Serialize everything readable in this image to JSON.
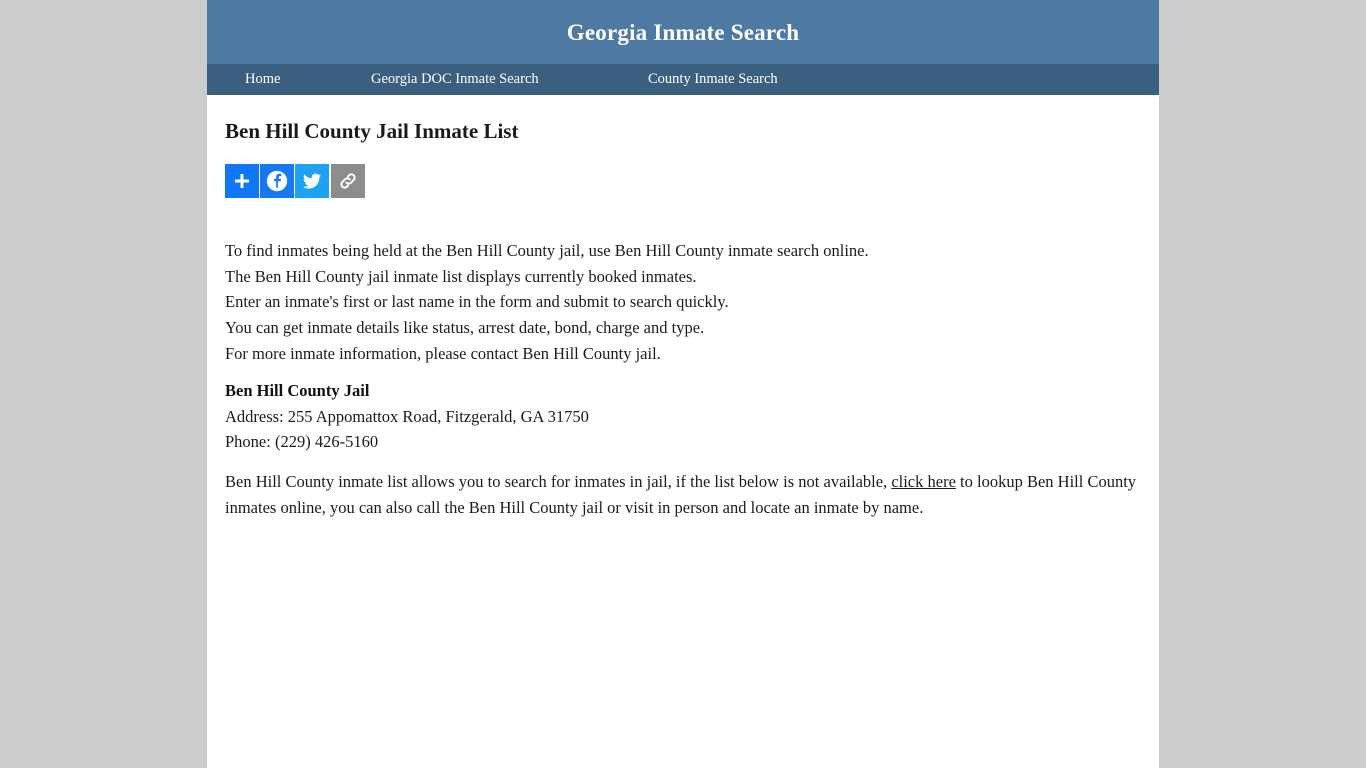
{
  "site": {
    "title": "Georgia Inmate Search"
  },
  "nav": {
    "items": [
      {
        "label": "Home",
        "name": "nav-item-home"
      },
      {
        "label": "Georgia DOC Inmate Search",
        "name": "nav-item-georgia-doc-inmate-search"
      },
      {
        "label": "County Inmate Search",
        "name": "nav-item-county-inmate-search"
      }
    ]
  },
  "page": {
    "title": "Ben Hill County Jail Inmate List"
  },
  "share": {
    "buttons": [
      {
        "label": "Share",
        "icon": "plus-icon",
        "color": "#0f76f5"
      },
      {
        "label": "Facebook",
        "icon": "facebook-icon",
        "color": "#1877f2"
      },
      {
        "label": "Twitter",
        "icon": "twitter-icon",
        "color": "#1da1f2"
      },
      {
        "label": "Copy Link",
        "icon": "link-icon",
        "color": "#8c8c8c"
      }
    ]
  },
  "intro": {
    "lines": [
      "To find inmates being held at the Ben Hill County jail, use Ben Hill County inmate search online.",
      "The Ben Hill County jail inmate list displays currently booked inmates.",
      "Enter an inmate's first or last name in the form and submit to search quickly.",
      "You can get inmate details like status, arrest date, bond, charge and type.",
      "For more inmate information, please contact Ben Hill County jail."
    ]
  },
  "jail": {
    "name": "Ben Hill County Jail",
    "address": "Address: 255 Appomattox Road, Fitzgerald, GA 31750",
    "phone": "Phone: (229) 426-5160"
  },
  "closing": {
    "before_link": "Ben Hill County inmate list allows you to search for inmates in jail, if the list below is not available, ",
    "link_text": "click here",
    "after_link": " to lookup Ben Hill County inmates online, you can also call the Ben Hill County jail or visit in person and locate an inmate by name."
  },
  "colors": {
    "page_background": "#cccccc",
    "masthead": "#4e79a2",
    "navbar": "#3b5f7f",
    "content_background": "#ffffff",
    "text": "#1b1b1b"
  }
}
